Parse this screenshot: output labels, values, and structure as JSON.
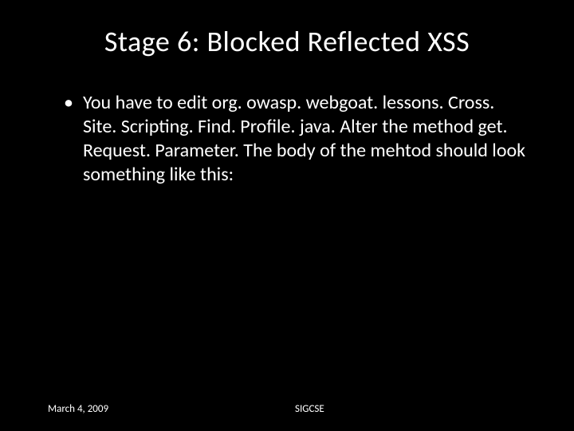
{
  "slide": {
    "title": "Stage  6: Blocked Reflected XSS",
    "bullet_marker": "•",
    "body_text": "You have to edit org. owasp. webgoat. lessons. Cross. Site. Scripting. Find. Profile. java. Alter the method get. Request. Parameter. The body of the mehtod should look something like this:"
  },
  "footer": {
    "date": "March 4, 2009",
    "center": "SIGCSE"
  }
}
